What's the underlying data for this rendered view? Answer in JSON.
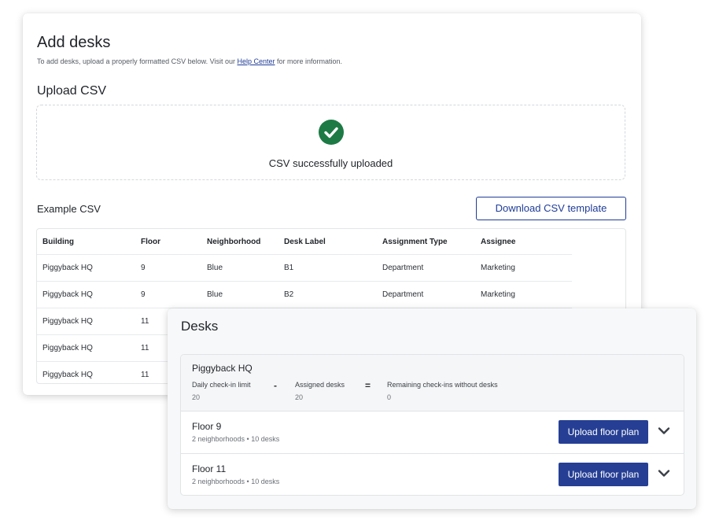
{
  "add_desks": {
    "title": "Add desks",
    "subtitle_prefix": "To add desks, upload a properly formatted CSV below. Visit our ",
    "help_link": "Help Center",
    "subtitle_suffix": " for more information.",
    "upload_title": "Upload CSV",
    "upload_status": "CSV successfully uploaded",
    "status_icon": "check-circle-icon",
    "example_label": "Example CSV",
    "download_button": "Download CSV template",
    "accent_color": "#1f3c97",
    "success_color": "#1d7a45",
    "table": {
      "headers": [
        "Building",
        "Floor",
        "Neighborhood",
        "Desk Label",
        "Assignment Type",
        "Assignee"
      ],
      "rows": [
        [
          "Piggyback HQ",
          "9",
          "Blue",
          "B1",
          "Department",
          "Marketing"
        ],
        [
          "Piggyback HQ",
          "9",
          "Blue",
          "B2",
          "Department",
          "Marketing"
        ],
        [
          "Piggyback HQ",
          "11",
          "",
          "",
          "",
          ""
        ],
        [
          "Piggyback HQ",
          "11",
          "",
          "",
          "",
          ""
        ],
        [
          "Piggyback HQ",
          "11",
          "",
          "",
          "",
          ""
        ]
      ]
    }
  },
  "desks": {
    "title": "Desks",
    "building": {
      "name": "Piggyback HQ",
      "daily_limit_label": "Daily check-in limit",
      "daily_limit_value": "20",
      "minus_op": "-",
      "assigned_label": "Assigned desks",
      "assigned_value": "20",
      "equals_op": "=",
      "remaining_label": "Remaining check-ins without desks",
      "remaining_value": "0"
    },
    "floors": [
      {
        "name": "Floor 9",
        "meta": "2 neighborhoods • 10 desks",
        "button": "Upload floor plan",
        "icon": "chevron-down-icon"
      },
      {
        "name": "Floor 11",
        "meta": "2 neighborhoods • 10 desks",
        "button": "Upload floor plan",
        "icon": "chevron-down-icon"
      }
    ],
    "button_color": "#263f94"
  }
}
